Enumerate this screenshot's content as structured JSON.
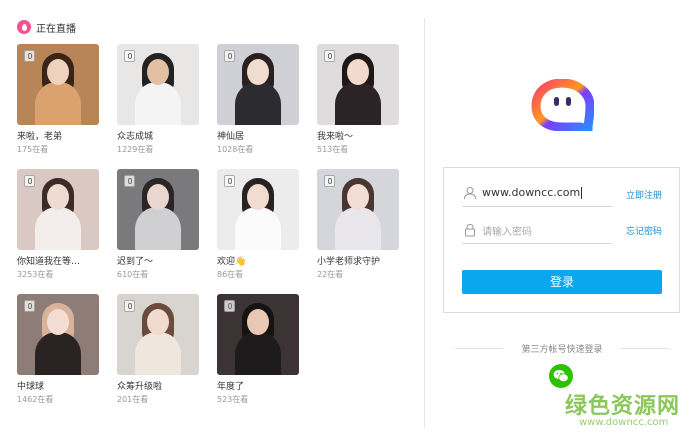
{
  "live": {
    "title": "正在直播",
    "streams": [
      {
        "name": "来啦，老弟",
        "viewers": "175在看",
        "bg": "#b78558",
        "skin": "#efd2bd",
        "hair": "#3a2418",
        "cloth": "#d9a26e"
      },
      {
        "name": "众志成城",
        "viewers": "1229在看",
        "bg": "#e9e7e5",
        "skin": "#e2c0a4",
        "hair": "#222",
        "cloth": "#f4f4f4"
      },
      {
        "name": "神仙居",
        "viewers": "1028在看",
        "bg": "#cfd0d6",
        "skin": "#f1dcd0",
        "hair": "#2a2020",
        "cloth": "#2b2b30"
      },
      {
        "name": "我来啦～",
        "viewers": "513在看",
        "bg": "#dfdcdd",
        "skin": "#f2dacd",
        "hair": "#1f1716",
        "cloth": "#2b2325"
      },
      {
        "name": "你知道我在等…",
        "viewers": "3253在看",
        "bg": "#d9c9c2",
        "skin": "#f0dbd3",
        "hair": "#3b2c28",
        "cloth": "#f3eeec"
      },
      {
        "name": "迟到了～",
        "viewers": "610在看",
        "bg": "#7a7a7c",
        "skin": "#e9d7cf",
        "hair": "#2b2526",
        "cloth": "#d0cfd1"
      },
      {
        "name": "欢迎👋",
        "viewers": "86在看",
        "bg": "#ececec",
        "skin": "#f1dccf",
        "hair": "#2a2222",
        "cloth": "#fbfbfb"
      },
      {
        "name": "小学老师求守护",
        "viewers": "22在看",
        "bg": "#d5d6dc",
        "skin": "#f3ddd4",
        "hair": "#4a3630",
        "cloth": "#e9e7ec"
      },
      {
        "name": "中球球",
        "viewers": "1462在看",
        "bg": "#8d7d76",
        "skin": "#f4ded4",
        "hair": "#d8b29b",
        "cloth": "#2a2324"
      },
      {
        "name": "众筹升级啦",
        "viewers": "201在看",
        "bg": "#d8d4cf",
        "skin": "#f0dbce",
        "hair": "#6a4b3d",
        "cloth": "#efe6de"
      },
      {
        "name": "年度了",
        "viewers": "523在看",
        "bg": "#3b3334",
        "skin": "#e6c8b4",
        "hair": "#161313",
        "cloth": "#1e1b1c"
      }
    ]
  },
  "logo": {
    "colors": [
      "#ff3e6a",
      "#ff9a1f",
      "#7d3cff",
      "#2a8cff"
    ]
  },
  "login": {
    "username_value": "www.downcc.com",
    "password_placeholder": "请输入密码",
    "register_link": "立即注册",
    "forgot_link": "忘记密码",
    "submit_label": "登录"
  },
  "third_party": {
    "label": "第三方帐号快速登录",
    "providers": [
      "wechat-icon"
    ]
  },
  "watermark": {
    "cn": "绿色资源网",
    "url": "www.downcc.com"
  },
  "colors": {
    "accent": "#0aa6ee",
    "link": "#1a8fd6",
    "live": "#ff4f8e",
    "wechat": "#2dc100"
  }
}
